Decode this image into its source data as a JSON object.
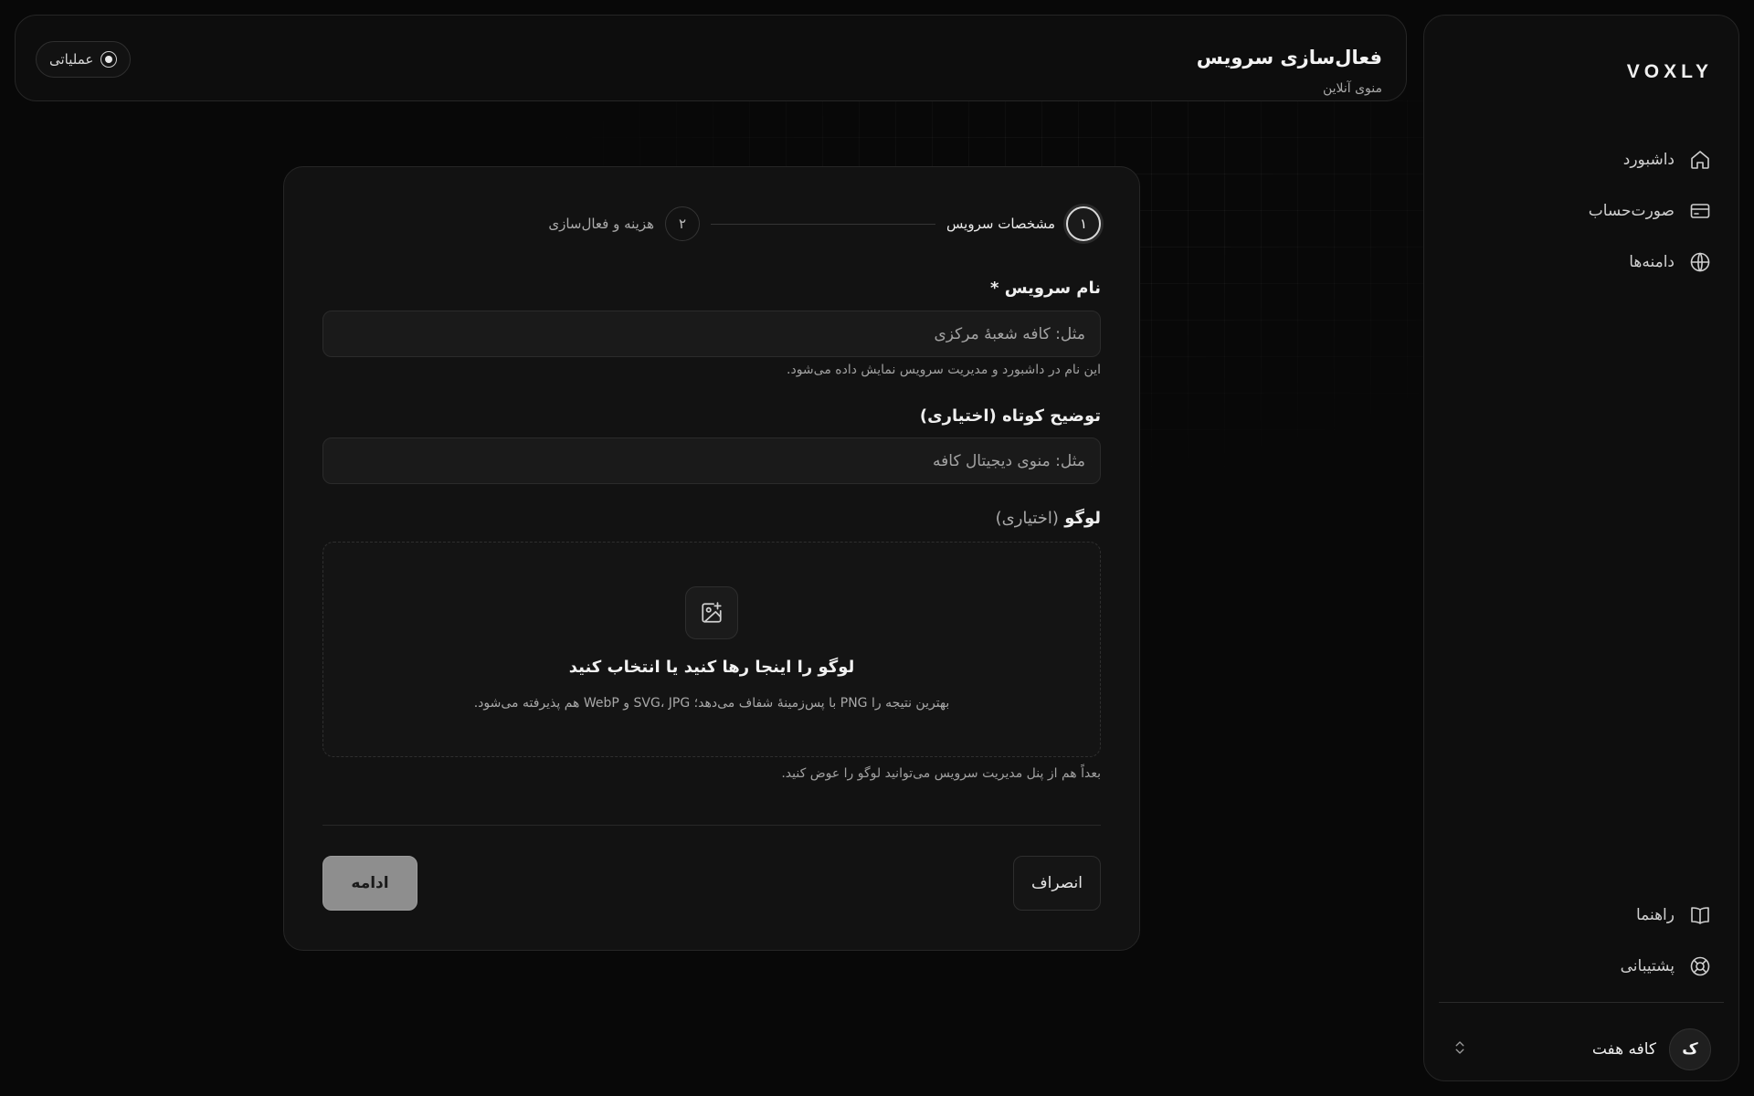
{
  "header": {
    "title": "فعال‌سازی سرویس",
    "subtitle": "منوی آنلاین",
    "status_label": "عملیاتی"
  },
  "sidebar": {
    "brand": "VOXLY",
    "nav_top": [
      {
        "label": "داشبورد",
        "icon": "home-icon"
      },
      {
        "label": "صورت‌حساب",
        "icon": "credit-card-icon"
      },
      {
        "label": "دامنه‌ها",
        "icon": "globe-icon"
      }
    ],
    "nav_bottom": [
      {
        "label": "راهنما",
        "icon": "book-icon"
      },
      {
        "label": "پشتیبانی",
        "icon": "lifebuoy-icon"
      }
    ],
    "account": {
      "avatar_letter": "ک",
      "name": "کافه هفت"
    }
  },
  "stepper": {
    "steps": [
      {
        "number": "۱",
        "label": "مشخصات سرویس",
        "state": "active"
      },
      {
        "number": "۲",
        "label": "هزینه و فعال‌سازی",
        "state": "idle"
      }
    ]
  },
  "form": {
    "service_name": {
      "label": "نام سرویس *",
      "placeholder": "مثل: کافه شعبهٔ مرکزی",
      "value": "",
      "hint": "این نام در داشبورد و مدیریت سرویس نمایش داده می‌شود."
    },
    "description": {
      "label": "توضیح کوتاه",
      "optional": "(اختیاری)",
      "placeholder": "مثل: منوی دیجیتال کافه",
      "value": ""
    },
    "logo": {
      "label": "لوگو",
      "optional": "(اختیاری)",
      "drop_title": "لوگو را اینجا رها کنید یا انتخاب کنید",
      "drop_subtitle": "بهترین نتیجه را PNG با پس‌زمینهٔ شفاف می‌دهد؛ SVG، JPG و WebP هم پذیرفته می‌شود.",
      "hint": "بعداً هم از پنل مدیریت سرویس می‌توانید لوگو را عوض کنید."
    },
    "cancel_label": "انصراف",
    "continue_label": "ادامه"
  }
}
